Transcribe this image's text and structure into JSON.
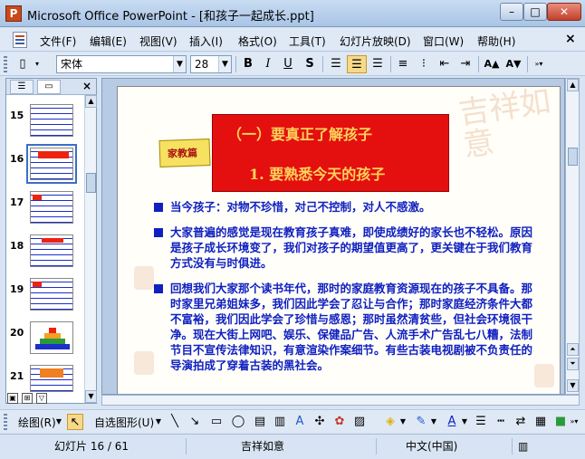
{
  "window": {
    "title": "Microsoft Office PowerPoint - [和孩子一起成长.ppt]",
    "app_icon_label": "P"
  },
  "window_buttons": {
    "minimize": "–",
    "maximize": "□",
    "close": "✕"
  },
  "menu": {
    "items": [
      "文件(F)",
      "编辑(E)",
      "视图(V)",
      "插入(I)",
      "格式(O)",
      "工具(T)",
      "幻灯片放映(D)",
      "窗口(W)",
      "帮助(H)"
    ],
    "close_glyph": "×"
  },
  "toolbar": {
    "font_name": "宋体",
    "font_size": "28",
    "bold": "B",
    "italic": "I",
    "underline": "U",
    "shadow": "S",
    "grow_font": "A▲",
    "shrink_font": "A▼"
  },
  "panel": {
    "close_glyph": "×",
    "slides": [
      {
        "num": "15"
      },
      {
        "num": "16",
        "selected": true
      },
      {
        "num": "17"
      },
      {
        "num": "18"
      },
      {
        "num": "19"
      },
      {
        "num": "20"
      },
      {
        "num": "21"
      }
    ]
  },
  "slide": {
    "badge": "家教篇",
    "title_line1": "（一）要真正了解孩子",
    "title_line2": "1. 要熟悉今天的孩子",
    "watermark": "吉祥如意",
    "bullets": [
      "当今孩子：对物不珍惜，对己不控制，对人不感激。",
      "大家普遍的感觉是现在教育孩子真难，即使成绩好的家长也不轻松。原因是孩子成长环境变了，我们对孩子的期望值更高了，更关键在于我们教育方式没有与时俱进。",
      "回想我们大家那个读书年代，那时的家庭教育资源现在的孩子不具备。那时家里兄弟姐妹多，我们因此学会了忍让与合作；那时家庭经济条件大都不富裕，我们因此学会了珍惜与感恩；那时虽然清贫些，但社会环境很干净。现在大街上网吧、娱乐、保健品广告、人流手术广告乱七八糟，法制节目不宣传法律知识，有意渲染作案细节。有些古装电视剧被不负责任的导演拍成了穿着古装的黑社会。"
    ]
  },
  "drawbar": {
    "draw_label": "绘图(R)",
    "autoshape_label": "自选图形(U)"
  },
  "status": {
    "slide_info": "幻灯片 16 / 61",
    "design": "吉祥如意",
    "language": "中文(中国)"
  },
  "colors": {
    "title_box": "#e40f0f",
    "title_text": "#ffd35c",
    "bullet_text": "#1020c0"
  }
}
